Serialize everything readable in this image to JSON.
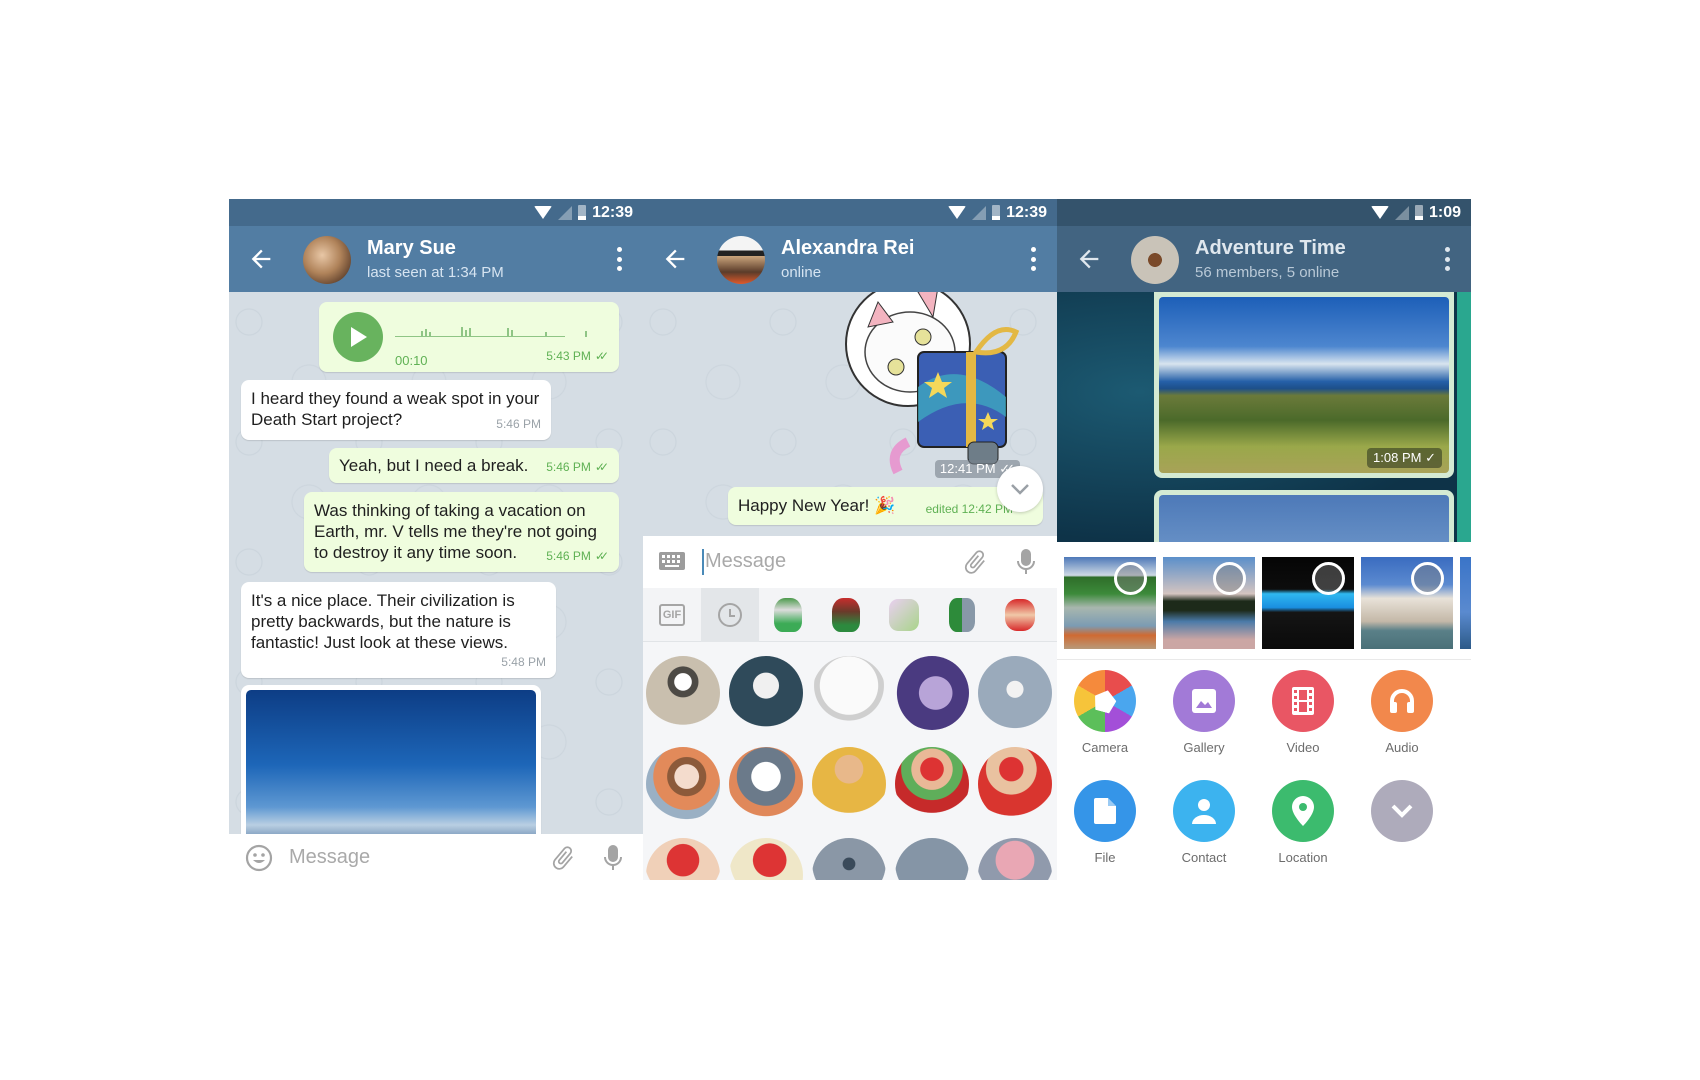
{
  "screens": [
    {
      "status_bar": {
        "time": "12:39"
      },
      "header": {
        "title": "Mary Sue",
        "subtitle": "last seen at 1:34 PM"
      },
      "messages": [
        {
          "type": "voice",
          "direction": "out",
          "duration": "00:10",
          "time": "5:43 PM",
          "read": true
        },
        {
          "type": "text",
          "direction": "in",
          "lines": [
            "I heard they found a weak spot in your",
            "Death Start project?"
          ],
          "time": "5:46 PM"
        },
        {
          "type": "text",
          "direction": "out",
          "lines": [
            "Yeah, but I need a break."
          ],
          "time": "5:46 PM",
          "read": true
        },
        {
          "type": "text",
          "direction": "out",
          "lines": [
            "Was thinking of taking a vacation on",
            "Earth, mr. V tells me they're not going",
            "to destroy it any time soon."
          ],
          "time": "5:46 PM",
          "read": true
        },
        {
          "type": "text",
          "direction": "in",
          "lines": [
            "It's a nice place. Their civilization is",
            "pretty backwards, but the nature is",
            "fantastic! Just look at these views."
          ],
          "time": "5:48 PM"
        },
        {
          "type": "photo",
          "direction": "in",
          "description": "blue sky with sun rays"
        }
      ],
      "input": {
        "placeholder": "Message"
      }
    },
    {
      "status_bar": {
        "time": "12:39"
      },
      "header": {
        "title": "Alexandra Rei",
        "subtitle": "online"
      },
      "messages": [
        {
          "type": "sticker",
          "direction": "out",
          "description": "astronaut cat holding gift box",
          "time": "12:41 PM",
          "read": true
        },
        {
          "type": "text",
          "direction": "out",
          "text": "Happy New Year! 🎉",
          "time": "edited 12:42 PM"
        }
      ],
      "input": {
        "placeholder": "Message"
      },
      "sticker_tabs": [
        "GIF",
        "recent",
        "pack-1",
        "pack-2",
        "pack-3",
        "pack-4",
        "pack-5"
      ],
      "stickers": [
        "raccoon",
        "bearded-man",
        "marilyn",
        "purple-hero",
        "crying-wolf",
        "girl-with-husky",
        "husky",
        "crying-man",
        "santa-money",
        "santa-bag",
        "laughing-santa",
        "santa-toast",
        "dj-rhino",
        "rhino",
        "elephant"
      ]
    },
    {
      "status_bar": {
        "time": "1:09"
      },
      "header": {
        "title": "Adventure Time",
        "subtitle": "56 members, 5 online"
      },
      "messages": [
        {
          "type": "photo",
          "direction": "out",
          "description": "green crater by the ocean",
          "time": "1:08 PM",
          "read": false
        }
      ],
      "attach_thumbs": [
        "lake-boat",
        "lake-sunset",
        "night-pool",
        "venice-church"
      ],
      "attach_options": [
        {
          "label": "Camera",
          "color": "#f5a623",
          "icon": "camera-icon"
        },
        {
          "label": "Gallery",
          "color": "#a27ad7",
          "icon": "gallery-icon"
        },
        {
          "label": "Video",
          "color": "#e95664",
          "icon": "video-icon"
        },
        {
          "label": "Audio",
          "color": "#f2884c",
          "icon": "headphones-icon"
        },
        {
          "label": "File",
          "color": "#3595e8",
          "icon": "file-icon"
        },
        {
          "label": "Contact",
          "color": "#3cb3ef",
          "icon": "contact-icon"
        },
        {
          "label": "Location",
          "color": "#3cbb6e",
          "icon": "location-icon"
        },
        {
          "label": "",
          "color": "#aeabbb",
          "icon": "chevron-down-icon"
        }
      ]
    }
  ]
}
